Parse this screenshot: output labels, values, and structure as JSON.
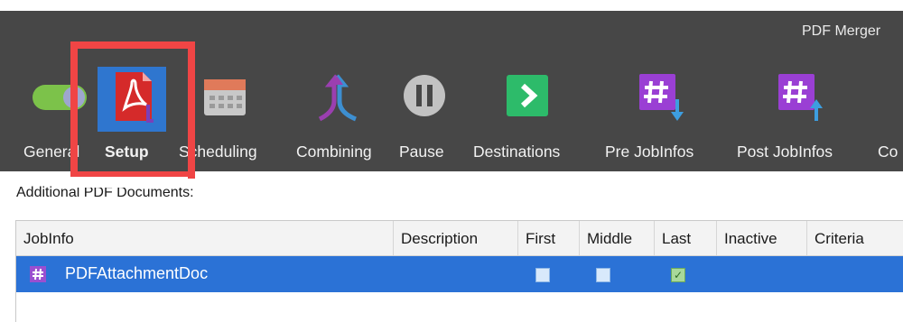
{
  "app": {
    "title": "PDF Merger"
  },
  "toolbar": {
    "items": [
      {
        "label": "General",
        "icon": "toggle-switch-icon"
      },
      {
        "label": "Setup",
        "icon": "pdf-document-icon",
        "selected": true
      },
      {
        "label": "Scheduling",
        "icon": "calendar-icon"
      },
      {
        "label": "Combining",
        "icon": "merge-arrows-icon"
      },
      {
        "label": "Pause",
        "icon": "pause-circle-icon"
      },
      {
        "label": "Destinations",
        "icon": "arrow-right-box-icon"
      },
      {
        "label": "Pre JobInfos",
        "icon": "hash-down-icon"
      },
      {
        "label": "Post JobInfos",
        "icon": "hash-up-icon"
      },
      {
        "label": "Co",
        "icon": ""
      }
    ]
  },
  "section": {
    "label": "Additional PDF Documents:"
  },
  "table": {
    "columns": [
      "JobInfo",
      "Description",
      "First",
      "Middle",
      "Last",
      "Inactive",
      "Criteria"
    ],
    "rows": [
      {
        "jobinfo": "PDFAttachmentDoc",
        "description": "",
        "first": false,
        "middle": false,
        "last": true,
        "inactive": null,
        "criteria": ""
      }
    ]
  },
  "colors": {
    "ribbon": "#474747",
    "selection": "#2b72d6",
    "annotation": "#f04545"
  }
}
